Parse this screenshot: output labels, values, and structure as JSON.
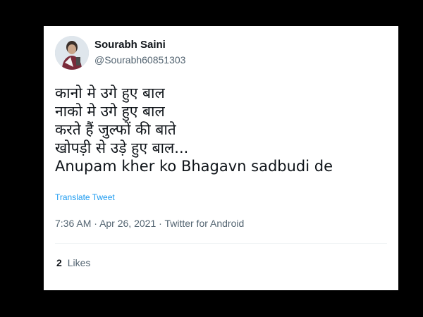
{
  "author": {
    "name": "Sourabh Saini",
    "handle": "@Sourabh60851303",
    "avatar_icon": "profile-photo"
  },
  "tweet": {
    "lines": [
      "कानो मे उगे हुए बाल",
      "नाको मे उगे हुए बाल",
      "करते हैं जुल्फों की बाते",
      "खोपड़ी से उड़े हुए बाल...",
      "Anupam kher ko Bhagavn sadbudi de"
    ],
    "translate_label": "Translate Tweet"
  },
  "meta": {
    "time": "7:36 AM",
    "separator": "·",
    "date": "Apr 26, 2021",
    "source": "Twitter for Android"
  },
  "stats": {
    "likes_count": "2",
    "likes_label": "Likes"
  },
  "colors": {
    "link": "#1d9bf0",
    "secondary_text": "#536471",
    "primary_text": "#0f1419",
    "frame": "#000000"
  }
}
